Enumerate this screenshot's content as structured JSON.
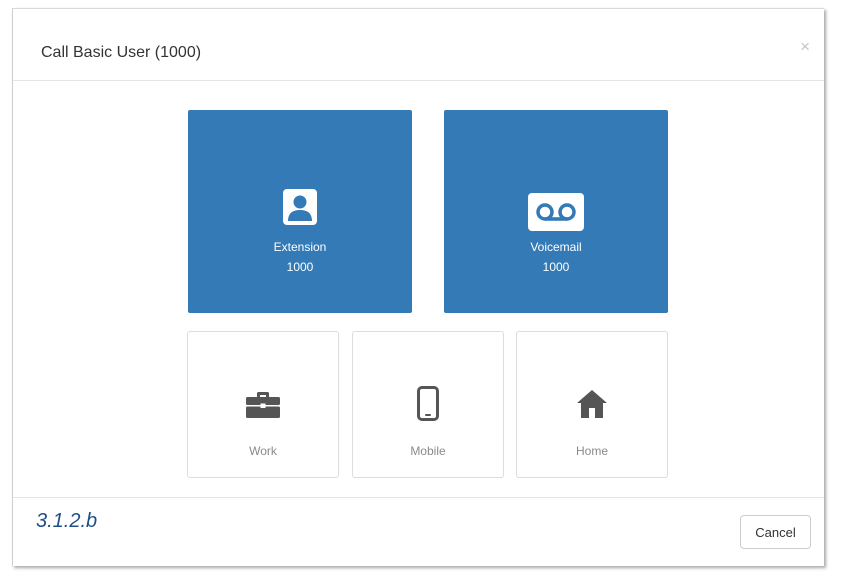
{
  "modal": {
    "title": "Call Basic User (1000)",
    "close_label": "×"
  },
  "tiles": {
    "extension": {
      "label": "Extension",
      "number": "1000",
      "icon": "user-portrait-icon"
    },
    "voicemail": {
      "label": "Voicemail",
      "number": "1000",
      "icon": "voicemail-icon"
    },
    "work": {
      "label": "Work",
      "icon": "briefcase-icon"
    },
    "mobile": {
      "label": "Mobile",
      "icon": "mobile-phone-icon"
    },
    "home": {
      "label": "Home",
      "icon": "home-icon"
    }
  },
  "footer": {
    "caption": "3.1.2.b",
    "cancel_label": "Cancel"
  },
  "colors": {
    "primary": "#337ab7",
    "secondary_icon": "#555555",
    "caption": "#1f4e8c"
  }
}
